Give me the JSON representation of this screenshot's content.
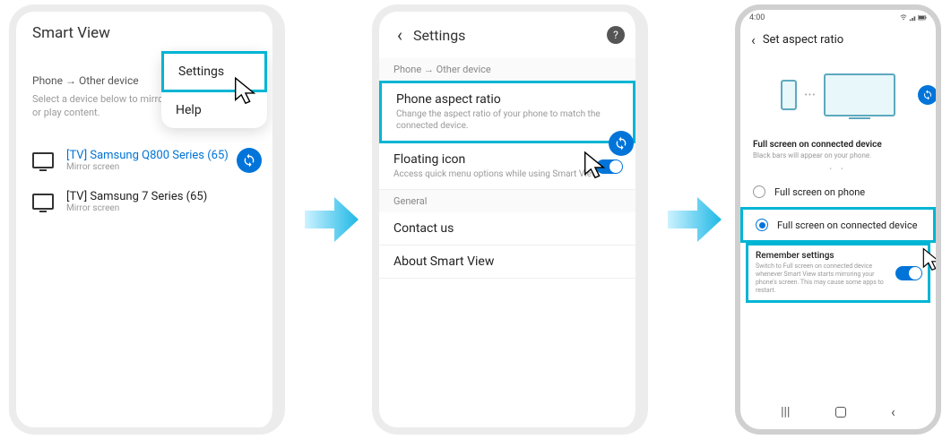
{
  "phone1": {
    "title": "Smart View",
    "menu": {
      "settings": "Settings",
      "help": "Help"
    },
    "section_label": "Phone → Other device",
    "section_desc": "Select a device below to mirror your phone's screen or play content.",
    "devices": [
      {
        "name": "[TV] Samsung Q800 Series (65)",
        "sub": "Mirror screen"
      },
      {
        "name": "[TV] Samsung 7 Series (65)",
        "sub": "Mirror screen"
      }
    ]
  },
  "phone2": {
    "title": "Settings",
    "section1_label": "Phone → Other device",
    "rows": {
      "aspect": {
        "title": "Phone aspect ratio",
        "desc": "Change the aspect ratio of your phone to match the connected device."
      },
      "floating": {
        "title": "Floating icon",
        "desc": "Access quick menu options while using Smart View."
      }
    },
    "section2_label": "General",
    "contact": "Contact us",
    "about": "About Smart View"
  },
  "phone3": {
    "time": "4:00",
    "title": "Set aspect ratio",
    "section_title": "Full screen on connected device",
    "section_desc": "Black bars will appear on your phone.",
    "option1": "Full screen on phone",
    "option2": "Full screen on connected device",
    "remember_title": "Remember settings",
    "remember_desc": "Switch to Full screen on connected device whenever Smart View starts mirroring your phone's screen. This may cause some apps to restart.",
    "nav_recent": "|||"
  }
}
